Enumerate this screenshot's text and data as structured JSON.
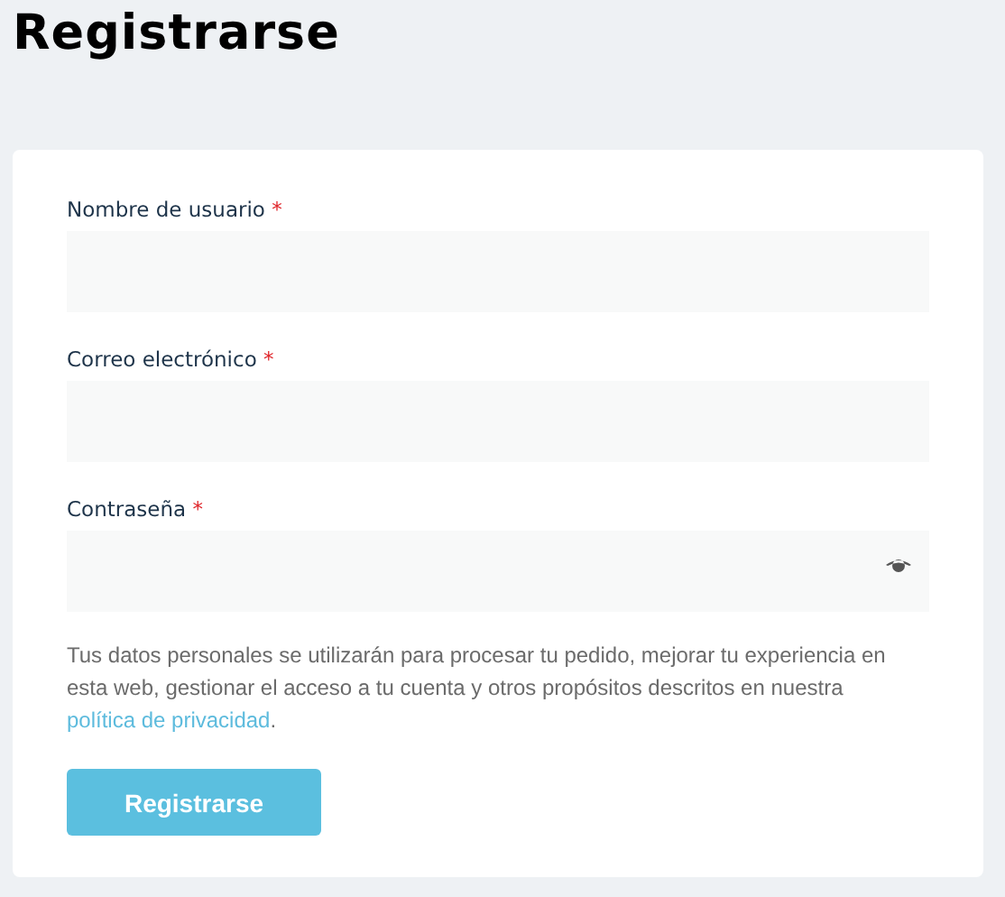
{
  "page_title": "Registrarse",
  "fields": [
    {
      "label": "Nombre de usuario",
      "required_mark": "*",
      "kind": "text"
    },
    {
      "label": "Correo electrónico",
      "required_mark": "*",
      "kind": "email"
    },
    {
      "label": "Contraseña",
      "required_mark": "*",
      "kind": "password"
    }
  ],
  "privacy_notice": {
    "text": "Tus datos personales se utilizarán para procesar tu pedido, mejorar tu experiencia en esta web, gestionar el acceso a tu cuenta y otros propósitos descritos en nuestra",
    "link": "política de privacidad",
    "end": "."
  },
  "submit_button": "Registrarse"
}
